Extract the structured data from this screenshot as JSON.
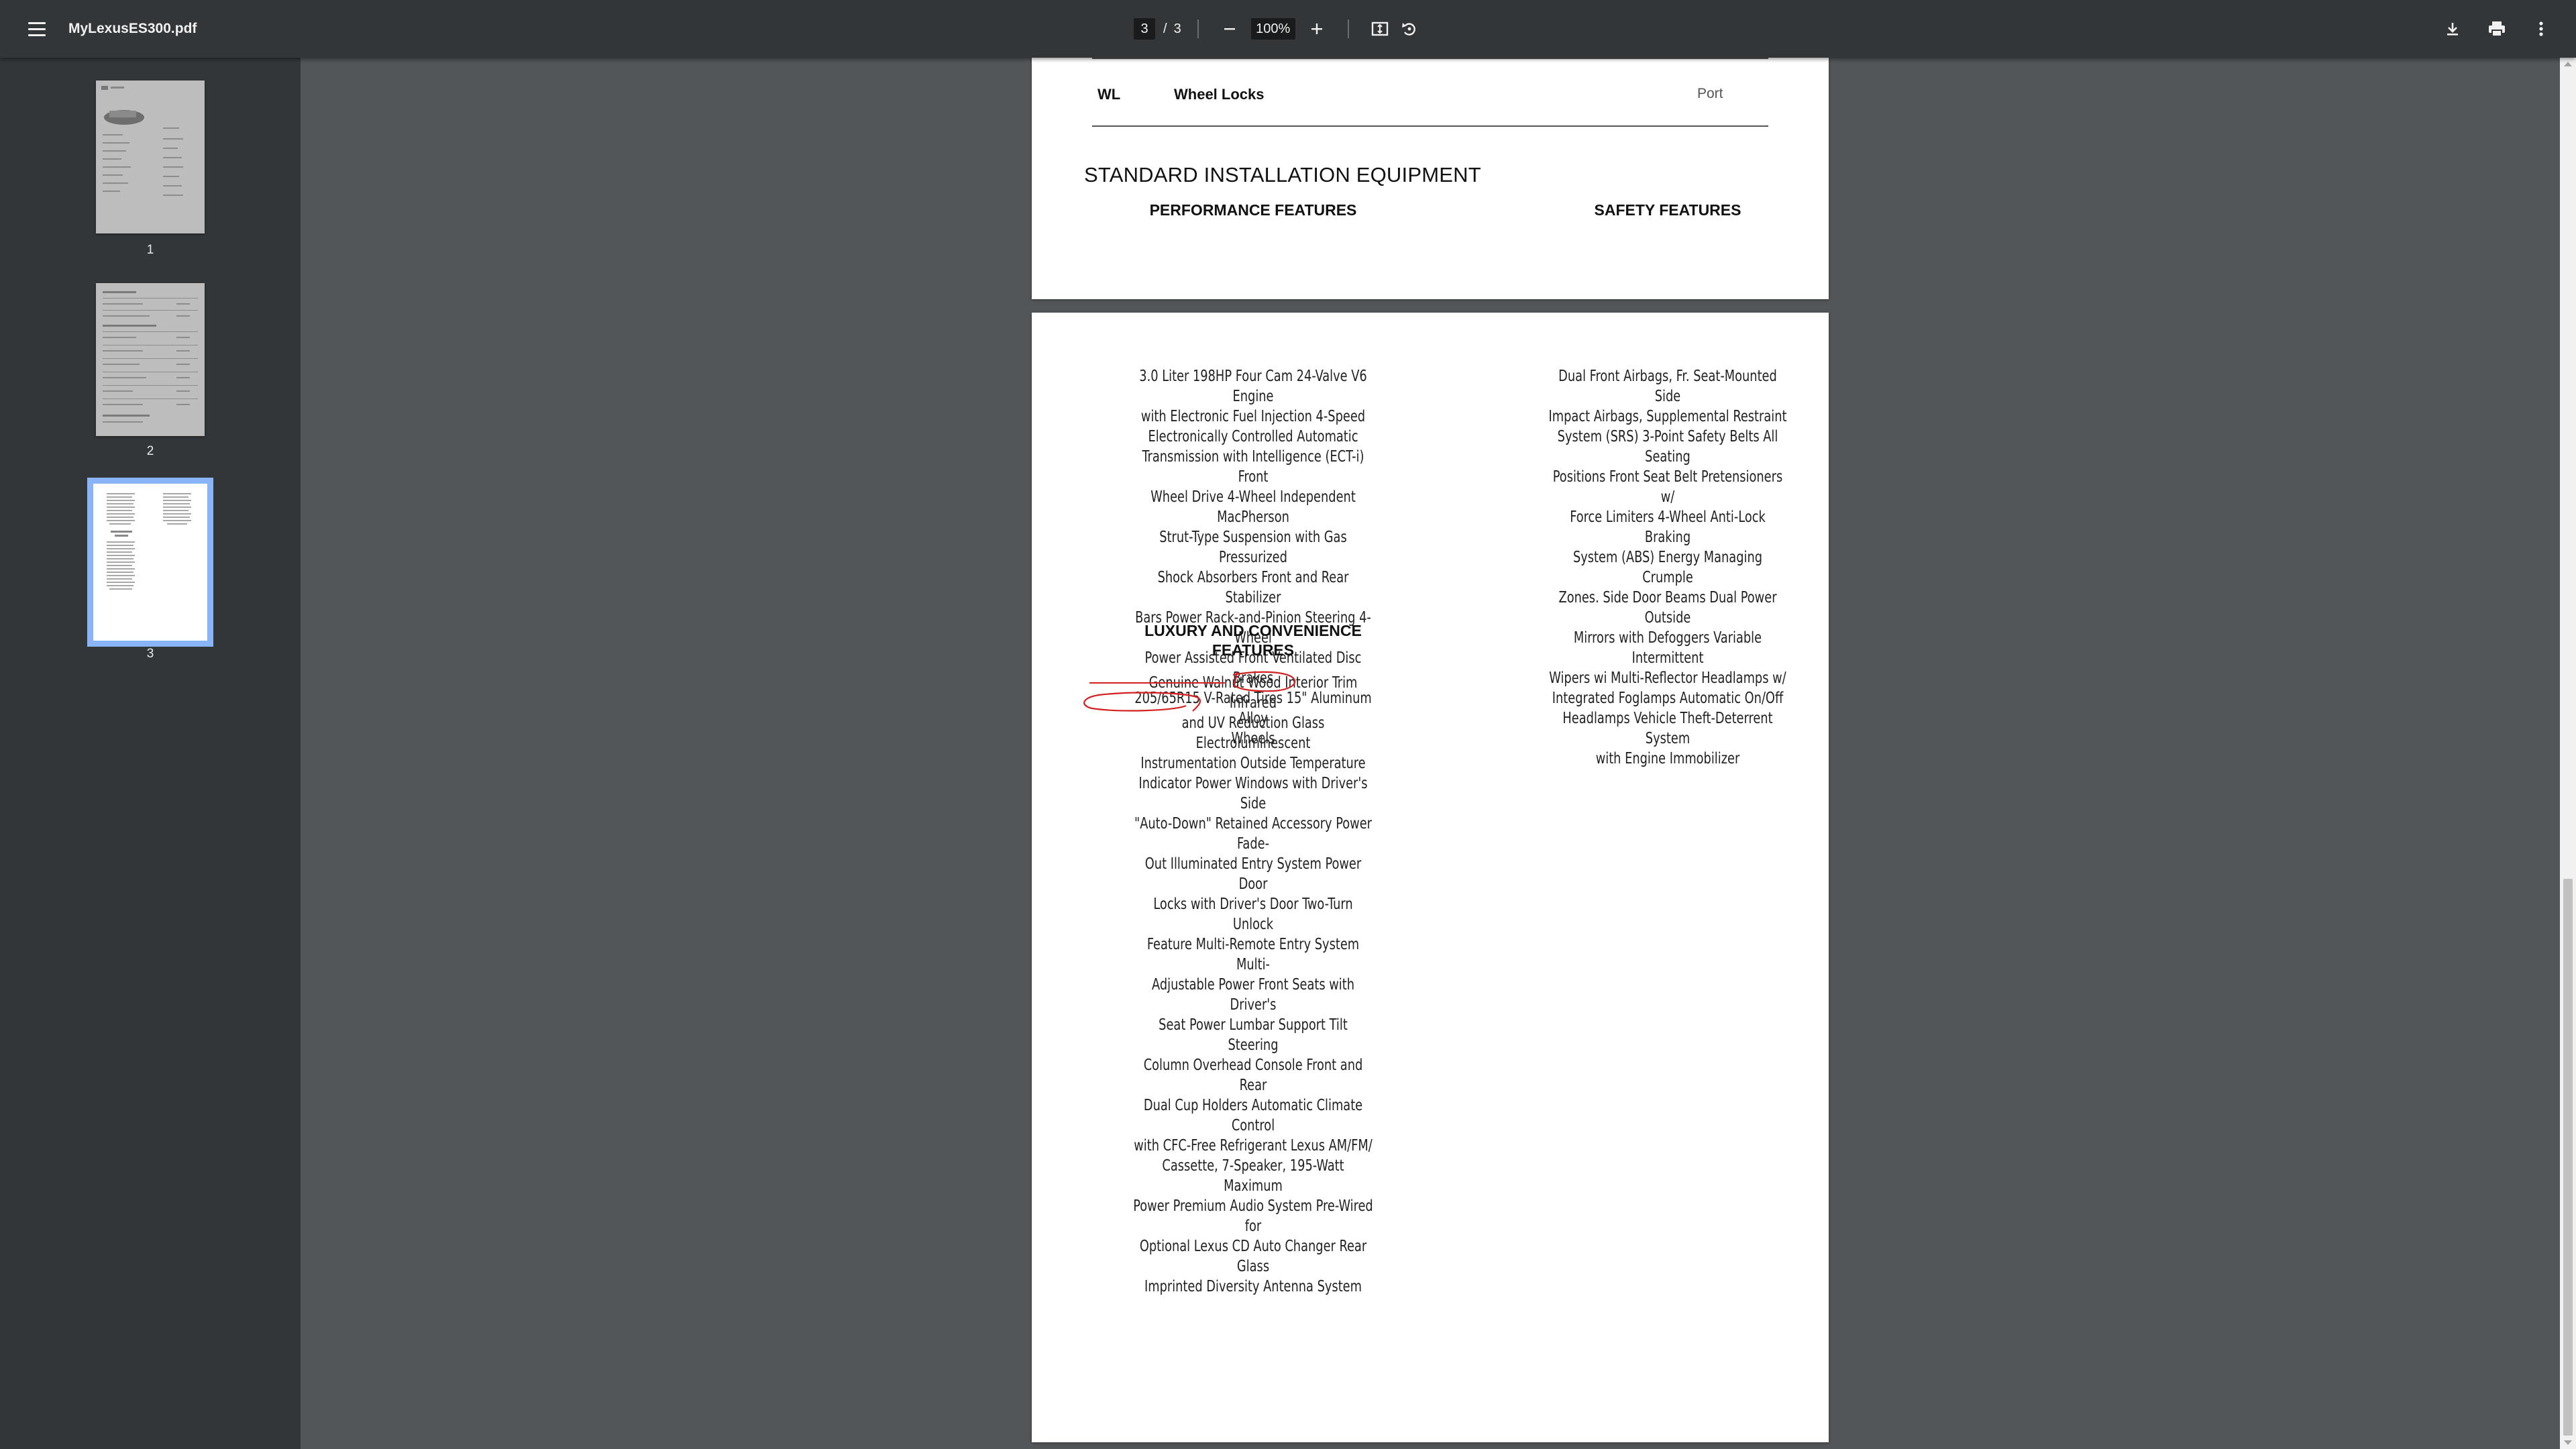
{
  "toolbar": {
    "file_name": "MyLexusES300.pdf",
    "current_page": "3",
    "page_separator": "/",
    "total_pages": "3",
    "zoom": "100%"
  },
  "sidebar": {
    "thumbnails": [
      {
        "label": "1"
      },
      {
        "label": "2"
      },
      {
        "label": "3",
        "selected": true
      }
    ]
  },
  "document": {
    "accessory_row": {
      "code": "WL",
      "name": "Wheel Locks",
      "type": "Port"
    },
    "section_title": "STANDARD INSTALLATION EQUIPMENT",
    "performance_heading": "PERFORMANCE FEATURES",
    "safety_heading": "SAFETY FEATURES",
    "performance_lines": [
      "3.0 Liter 198HP Four Cam 24-Valve V6 Engine",
      "with Electronic Fuel Injection 4-Speed",
      "Electronically Controlled Automatic",
      "Transmission with Intelligence (ECT-i) Front",
      "Wheel Drive 4-Wheel Independent MacPherson",
      "Strut-Type Suspension with Gas Pressurized",
      "Shock Absorbers Front and Rear Stabilizer",
      "Bars Power Rack-and-Pinion Steering 4-Wheel",
      "Power Assisted Front Ventilated Disc Brakes",
      "205/65R15 V-Rated Tires 15\" Aluminum Alloy",
      "Wheels"
    ],
    "safety_lines": [
      "Dual Front Airbags, Fr. Seat-Mounted Side",
      "Impact Airbags, Supplemental Restraint",
      "System (SRS) 3-Point Safety Belts All Seating",
      "Positions Front Seat Belt Pretensioners w/",
      "Force Limiters 4-Wheel Anti-Lock Braking",
      "System (ABS) Energy Managing Crumple",
      "Zones. Side Door Beams Dual Power Outside",
      "Mirrors with Defoggers Variable Intermittent",
      "Wipers wi Multi-Reflector Headlamps w/",
      "Integrated Foglamps Automatic On/Off",
      "Headlamps Vehicle Theft-Deterrent System",
      "with Engine Immobilizer"
    ],
    "luxury_heading_line1": "LUXURY AND CONVENIENCE",
    "luxury_heading_line2": "FEATURES",
    "luxury_lines": [
      "Genuine Walnut Wood Interior Trim Infrared",
      "and UV Reduction Glass Electroluminescent",
      "Instrumentation Outside Temperature",
      "Indicator Power Windows with Driver's Side",
      "\"Auto-Down\" Retained Accessory Power Fade-",
      "Out Illuminated Entry System Power Door",
      "Locks with Driver's Door Two-Turn Unlock",
      "Feature Multi-Remote Entry System Multi-",
      "Adjustable Power Front Seats with Driver's",
      "Seat Power Lumbar Support Tilt Steering",
      "Column Overhead Console Front and Rear",
      "Dual Cup Holders Automatic Climate Control",
      "with CFC-Free Refrigerant Lexus AM/FM/",
      "Cassette, 7-Speaker, 195-Watt Maximum",
      "Power Premium Audio System Pre-Wired for",
      "Optional Lexus CD Auto Changer Rear Glass",
      "Imprinted Diversity Antenna System"
    ]
  },
  "colors": {
    "toolbar_bg": "#323639",
    "viewer_bg": "#525659",
    "selection_outline": "#8ab4f8",
    "annotation_red": "#d32020"
  },
  "icons": {
    "menu": "hamburger-menu-icon",
    "zoom_out": "minus-icon",
    "zoom_in": "plus-icon",
    "fit": "fit-to-page-icon",
    "rotate": "rotate-counterclockwise-icon",
    "download": "download-icon",
    "print": "print-icon",
    "more": "more-vertical-icon"
  }
}
